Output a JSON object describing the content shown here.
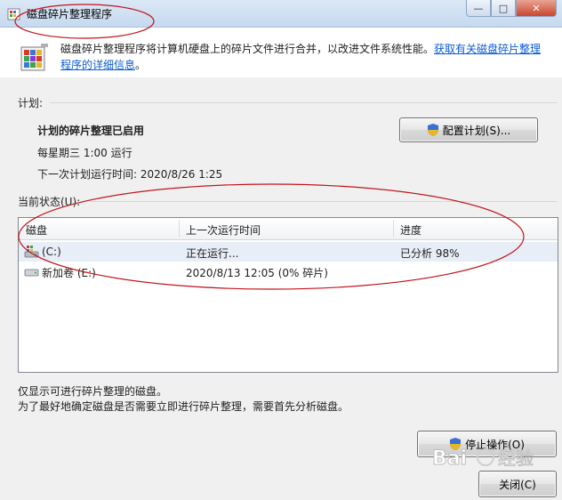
{
  "window": {
    "title": "磁盘碎片整理程序",
    "minimize_icon": "minimize-icon",
    "maximize_icon": "maximize-icon",
    "close_icon": "close-icon"
  },
  "description": {
    "text": "磁盘碎片整理程序将计算机硬盘上的碎片文件进行合并，以改进文件系统性能。",
    "link": "获取有关磁盘碎片整理程序的详细信息",
    "link_end": "。"
  },
  "schedule": {
    "section_label": "计划:",
    "status": "计划的碎片整理已启用",
    "frequency": "每星期三  1:00 运行",
    "next_run": "下一次计划运行时间: 2020/8/26 1:25",
    "configure_button": "配置计划(S)..."
  },
  "current_status": {
    "section_label": "当前状态(U):",
    "columns": [
      "磁盘",
      "上一次运行时间",
      "进度"
    ],
    "rows": [
      {
        "disk": "(C:)",
        "last_run": "正在运行...",
        "progress": "已分析 98%",
        "icon": "system-drive-icon"
      },
      {
        "disk": "新加卷 (E:)",
        "last_run": "2020/8/13 12:05 (0% 碎片)",
        "progress": "",
        "icon": "drive-icon"
      }
    ]
  },
  "notes": {
    "line1": "仅显示可进行碎片整理的磁盘。",
    "line2": "为了最好地确定磁盘是否需要立即进行碎片整理，需要首先分析磁盘。"
  },
  "buttons": {
    "stop": "停止操作(O)",
    "close": "关闭(C)"
  },
  "watermark": "Bai 经验",
  "colors": {
    "annotation": "#c0161d",
    "link": "#0b5cd5"
  }
}
